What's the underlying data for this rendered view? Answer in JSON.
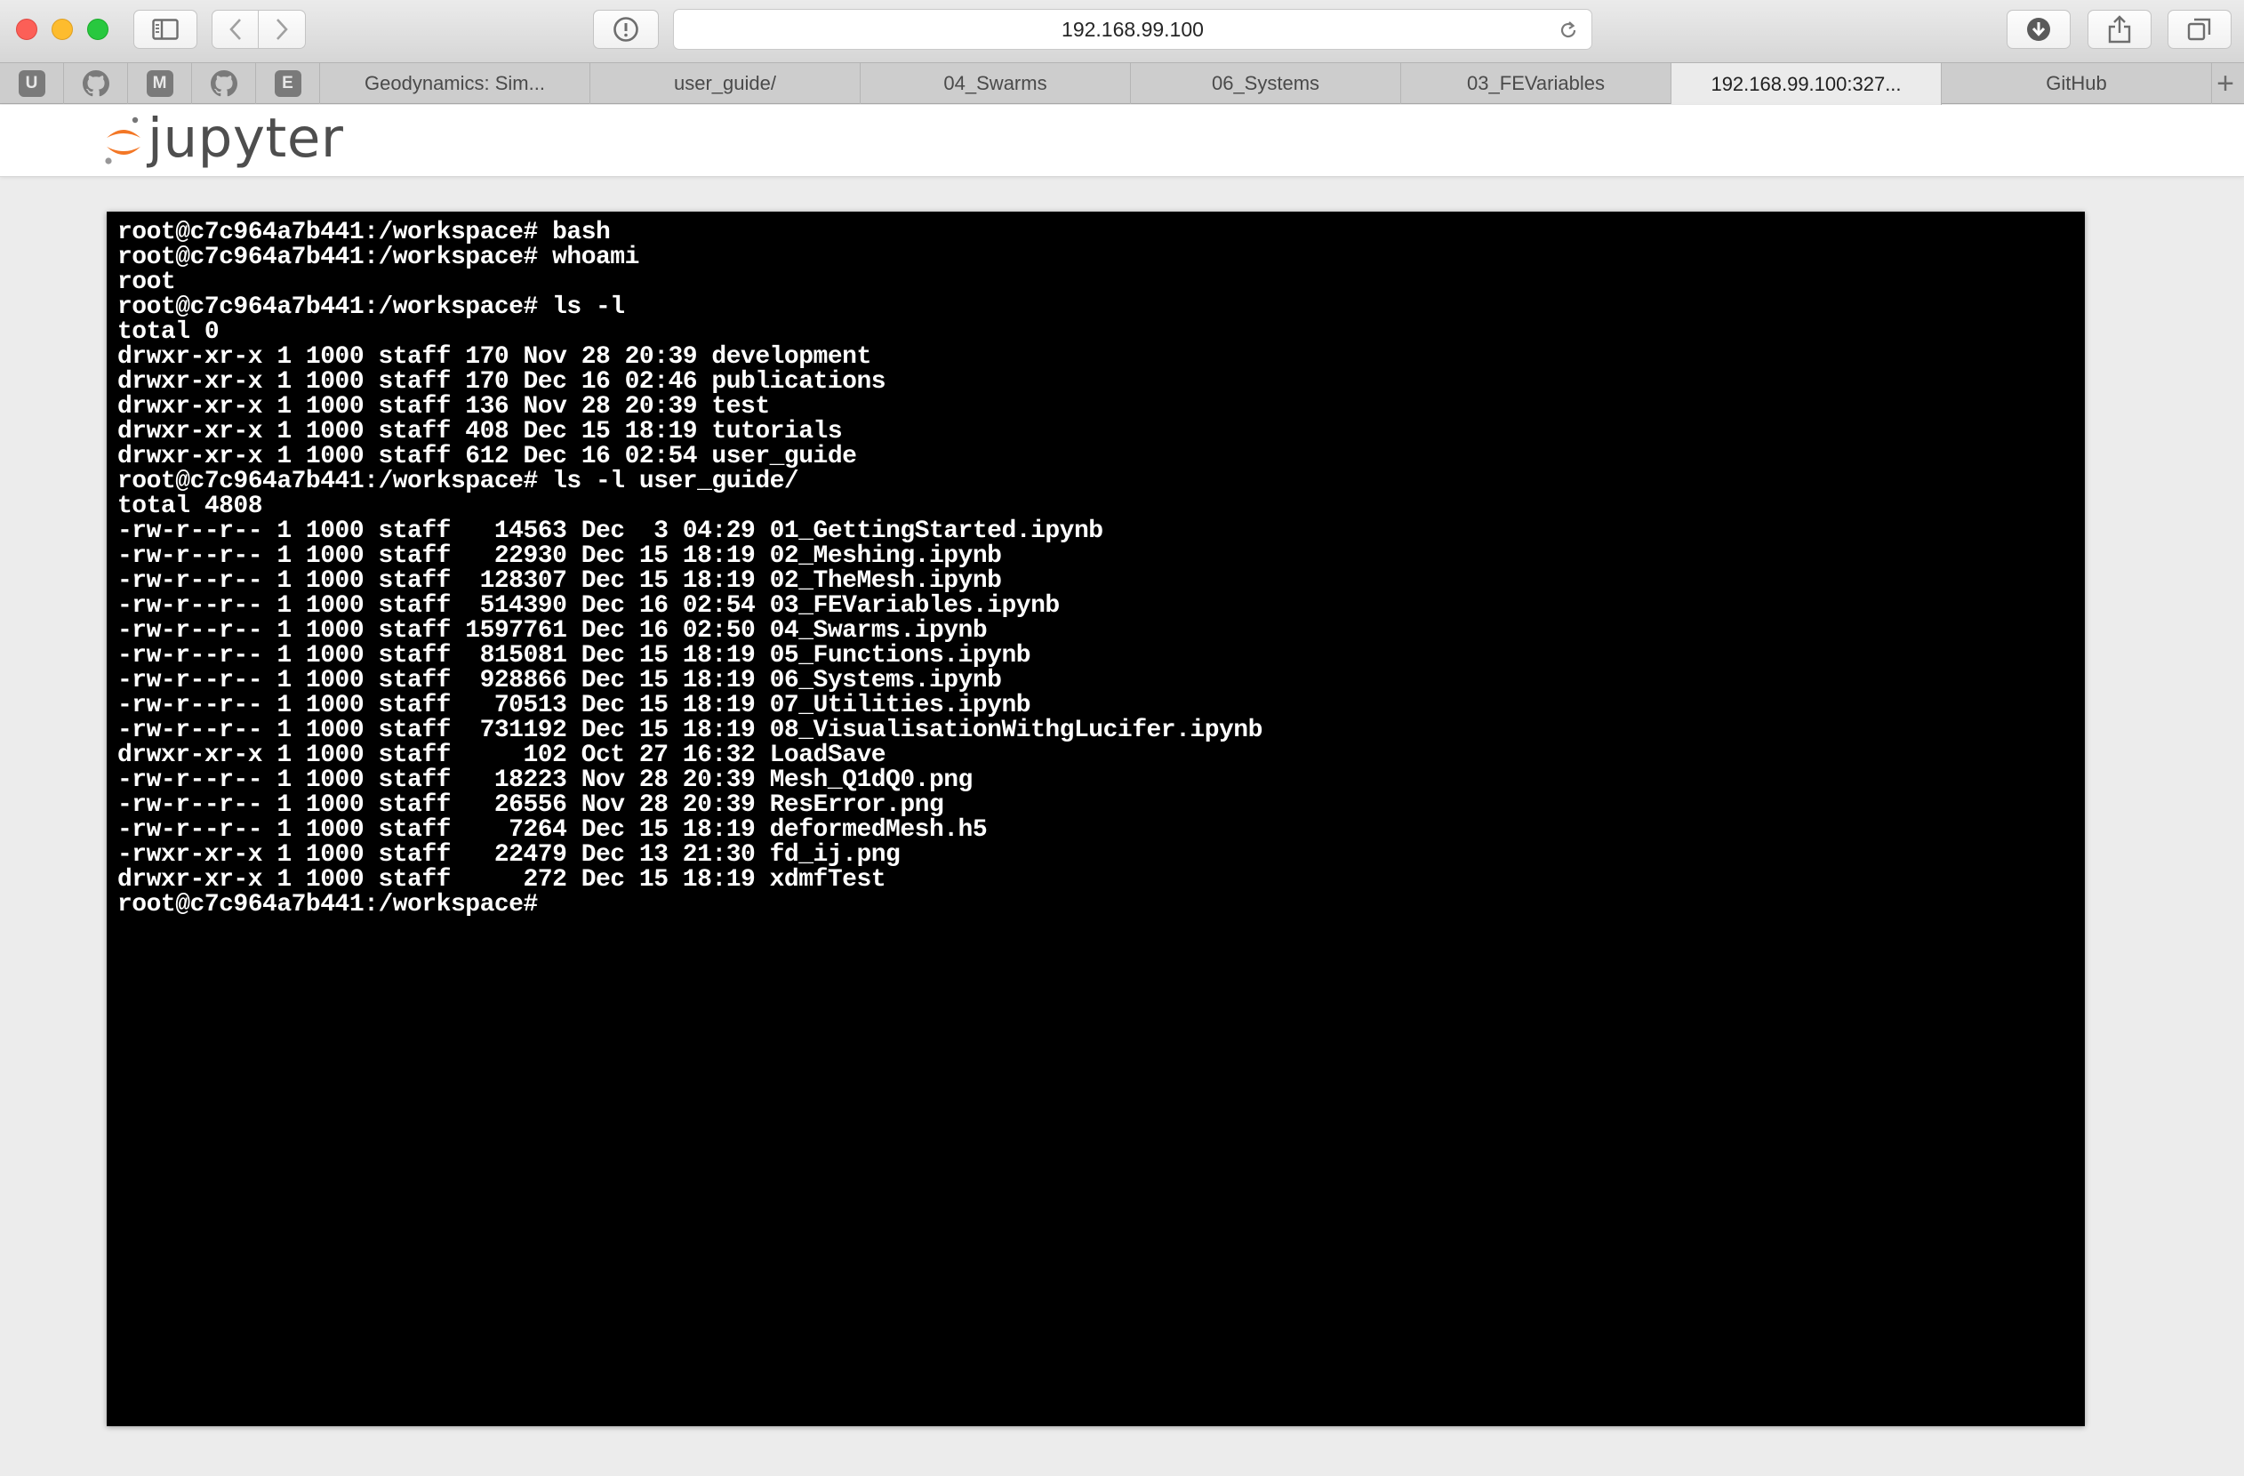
{
  "browser": {
    "url": "192.168.99.100",
    "pinned_tabs": [
      {
        "icon": "u-badge-icon",
        "label": "U"
      },
      {
        "icon": "github-icon",
        "label": ""
      },
      {
        "icon": "m-badge-icon",
        "label": "M"
      },
      {
        "icon": "github-icon",
        "label": ""
      },
      {
        "icon": "e-badge-icon",
        "label": "E"
      }
    ],
    "tabs": [
      {
        "label": "Geodynamics: Sim...",
        "active": false
      },
      {
        "label": "user_guide/",
        "active": false
      },
      {
        "label": "04_Swarms",
        "active": false
      },
      {
        "label": "06_Systems",
        "active": false
      },
      {
        "label": "03_FEVariables",
        "active": false
      },
      {
        "label": "192.168.99.100:327...",
        "active": true
      },
      {
        "label": "GitHub",
        "active": false
      }
    ],
    "new_tab_label": "+"
  },
  "jupyter": {
    "logo_text": "jupyter",
    "logo_colors": {
      "orange": "#f37726",
      "gray": "#767677"
    }
  },
  "terminal": {
    "lines": [
      "root@c7c964a7b441:/workspace# bash",
      "root@c7c964a7b441:/workspace# whoami",
      "root",
      "root@c7c964a7b441:/workspace# ls -l",
      "total 0",
      "drwxr-xr-x 1 1000 staff 170 Nov 28 20:39 development",
      "drwxr-xr-x 1 1000 staff 170 Dec 16 02:46 publications",
      "drwxr-xr-x 1 1000 staff 136 Nov 28 20:39 test",
      "drwxr-xr-x 1 1000 staff 408 Dec 15 18:19 tutorials",
      "drwxr-xr-x 1 1000 staff 612 Dec 16 02:54 user_guide",
      "root@c7c964a7b441:/workspace# ls -l user_guide/",
      "total 4808",
      "-rw-r--r-- 1 1000 staff   14563 Dec  3 04:29 01_GettingStarted.ipynb",
      "-rw-r--r-- 1 1000 staff   22930 Dec 15 18:19 02_Meshing.ipynb",
      "-rw-r--r-- 1 1000 staff  128307 Dec 15 18:19 02_TheMesh.ipynb",
      "-rw-r--r-- 1 1000 staff  514390 Dec 16 02:54 03_FEVariables.ipynb",
      "-rw-r--r-- 1 1000 staff 1597761 Dec 16 02:50 04_Swarms.ipynb",
      "-rw-r--r-- 1 1000 staff  815081 Dec 15 18:19 05_Functions.ipynb",
      "-rw-r--r-- 1 1000 staff  928866 Dec 15 18:19 06_Systems.ipynb",
      "-rw-r--r-- 1 1000 staff   70513 Dec 15 18:19 07_Utilities.ipynb",
      "-rw-r--r-- 1 1000 staff  731192 Dec 15 18:19 08_VisualisationWithgLucifer.ipynb",
      "drwxr-xr-x 1 1000 staff     102 Oct 27 16:32 LoadSave",
      "-rw-r--r-- 1 1000 staff   18223 Nov 28 20:39 Mesh_Q1dQ0.png",
      "-rw-r--r-- 1 1000 staff   26556 Nov 28 20:39 ResError.png",
      "-rw-r--r-- 1 1000 staff    7264 Dec 15 18:19 deformedMesh.h5",
      "-rwxr-xr-x 1 1000 staff   22479 Dec 13 21:30 fd_ij.png",
      "drwxr-xr-x 1 1000 staff     272 Dec 15 18:19 xdmfTest",
      "root@c7c964a7b441:/workspace# "
    ]
  }
}
